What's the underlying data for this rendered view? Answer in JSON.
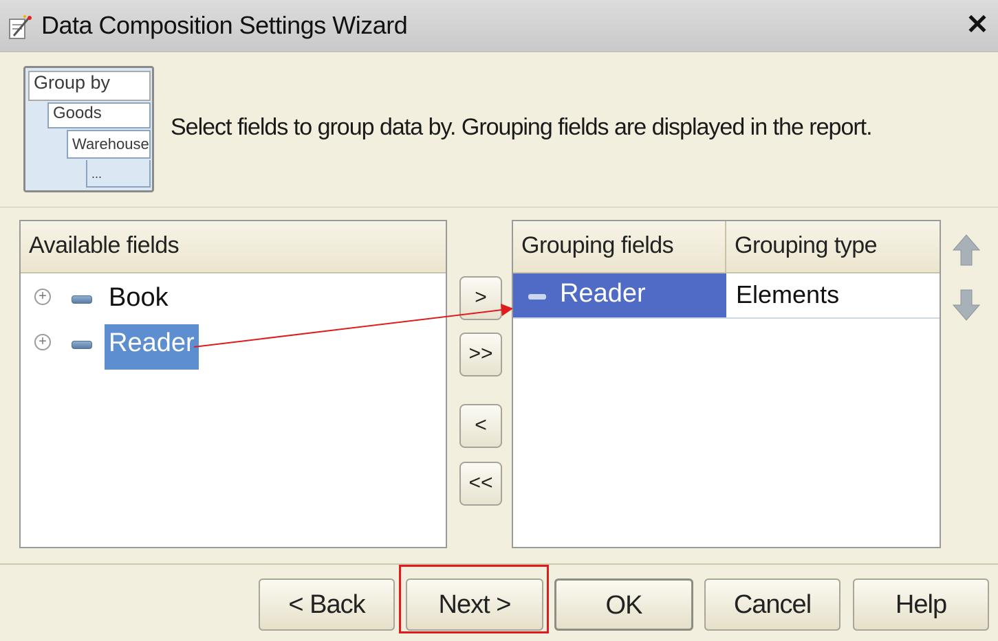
{
  "window": {
    "title": "Data Composition Settings Wizard",
    "close_label": "✕"
  },
  "header": {
    "icon_rows": [
      "Group by",
      "Goods",
      "Warehouse",
      "..."
    ],
    "description": "Select fields to group data by. Grouping fields are displayed in the report."
  },
  "available": {
    "header": "Available fields",
    "items": [
      {
        "label": "Book",
        "selected": false
      },
      {
        "label": "Reader",
        "selected": true
      }
    ]
  },
  "move_buttons": {
    "add": ">",
    "add_all": ">>",
    "remove": "<",
    "remove_all": "<<"
  },
  "grouping": {
    "headers": [
      "Grouping fields",
      "Grouping type"
    ],
    "rows": [
      {
        "field": "Reader",
        "type": "Elements",
        "selected": true
      }
    ]
  },
  "footer": {
    "back": "< Back",
    "next": "Next >",
    "ok": "OK",
    "cancel": "Cancel",
    "help": "Help"
  },
  "colors": {
    "selection_left": "#5d8fd0",
    "selection_right": "#4f6bc6",
    "annotation": "#e01b1b",
    "background": "#f3efde"
  }
}
